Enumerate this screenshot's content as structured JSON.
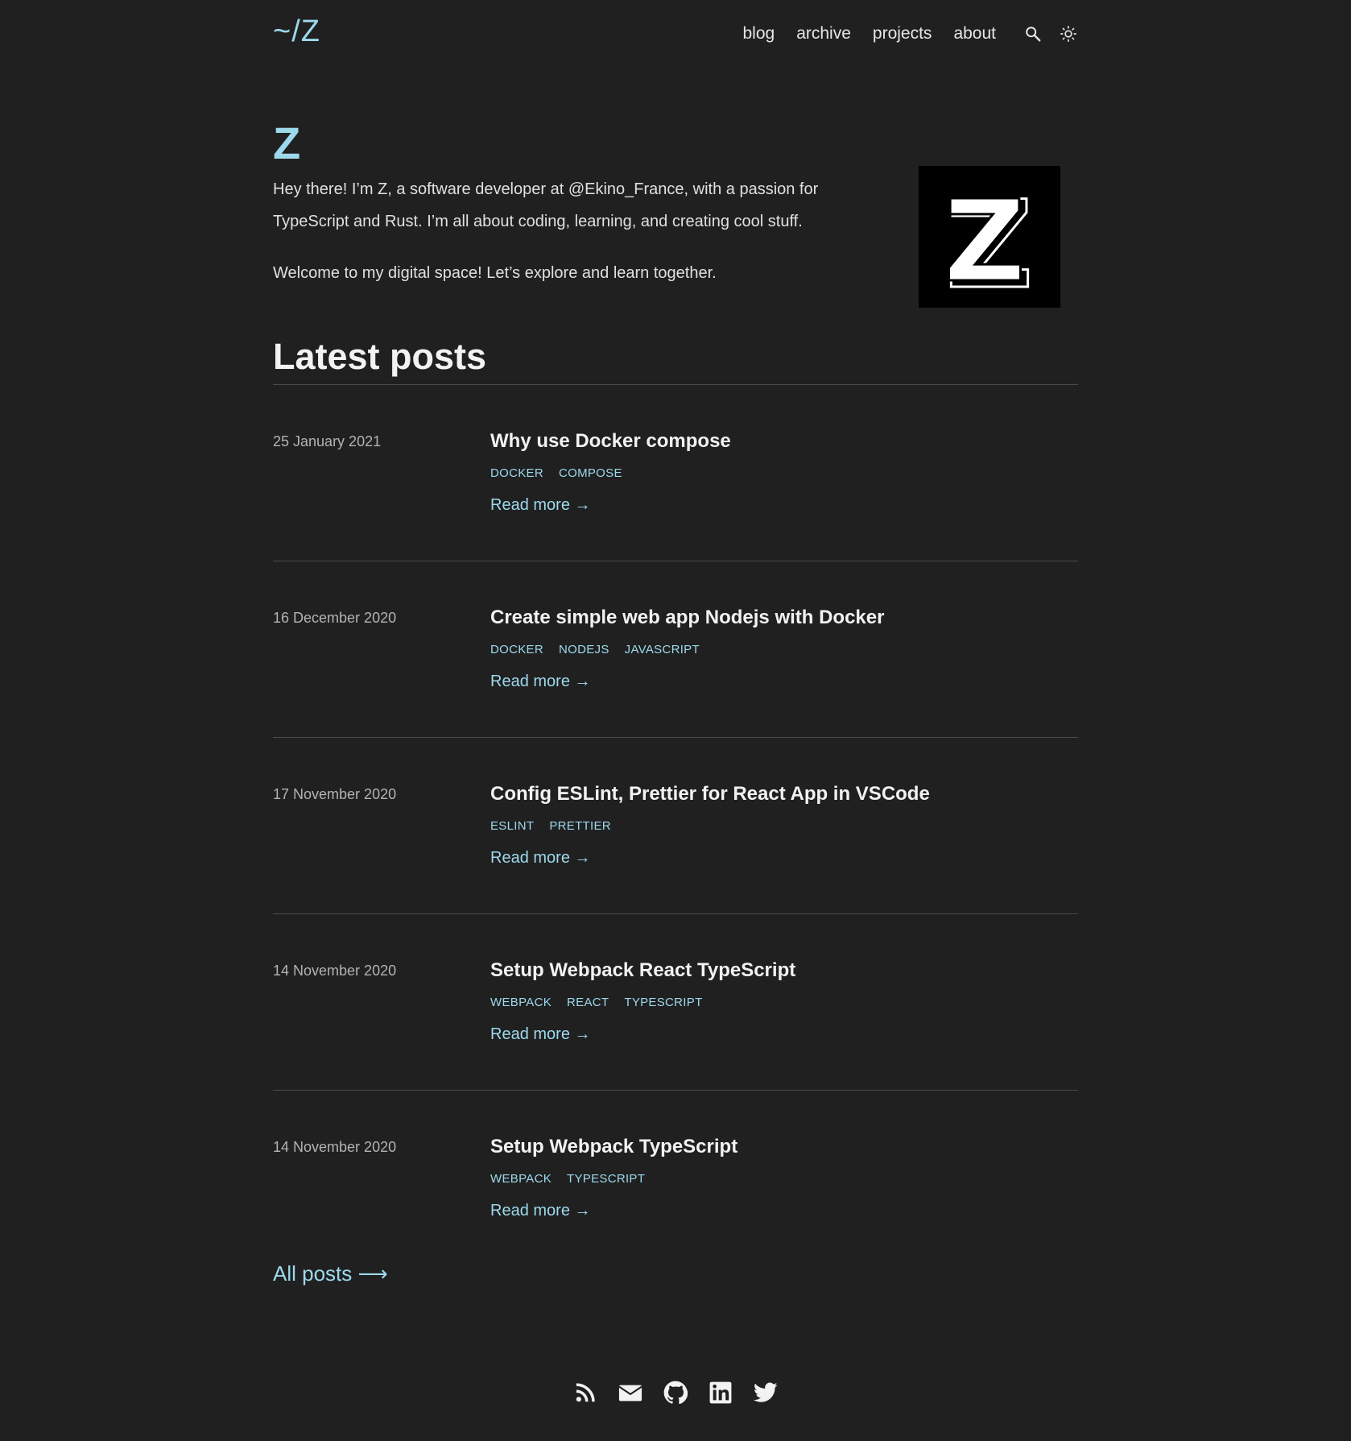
{
  "header": {
    "logo": "~/Z",
    "nav": [
      "blog",
      "archive",
      "projects",
      "about"
    ],
    "icons": [
      "search-icon",
      "sun-icon"
    ]
  },
  "intro": {
    "title": "Z",
    "paragraph1": "Hey there! I’m Z, a software developer at @Ekino_France, with a passion for TypeScript and Rust. I’m all about coding, learning, and creating cool stuff.",
    "paragraph2": "Welcome to my digital space! Let’s explore and learn together.",
    "avatar_letter": "Z"
  },
  "latest": {
    "title": "Latest posts",
    "read_more": "Read more →",
    "all_posts": "All posts ⟶",
    "posts": [
      {
        "date": "25 January 2021",
        "title": "Why use Docker compose",
        "tags": [
          "DOCKER",
          "COMPOSE"
        ]
      },
      {
        "date": "16 December 2020",
        "title": "Create simple web app Nodejs with Docker",
        "tags": [
          "DOCKER",
          "NODEJS",
          "JAVASCRIPT"
        ]
      },
      {
        "date": "17 November 2020",
        "title": "Config ESLint, Prettier for React App in VSCode",
        "tags": [
          "ESLINT",
          "PRETTIER"
        ]
      },
      {
        "date": "14 November 2020",
        "title": "Setup Webpack React TypeScript",
        "tags": [
          "WEBPACK",
          "REACT",
          "TYPESCRIPT"
        ]
      },
      {
        "date": "14 November 2020",
        "title": "Setup Webpack TypeScript",
        "tags": [
          "WEBPACK",
          "TYPESCRIPT"
        ]
      }
    ]
  },
  "footer": {
    "icons": [
      "rss-icon",
      "mail-icon",
      "github-icon",
      "linkedin-icon",
      "twitter-icon"
    ]
  },
  "colors": {
    "background": "#202020",
    "accent": "#9dd9ec",
    "text": "#e6e6e6",
    "muted": "#b3b3b3",
    "divider": "#4a4a4a"
  }
}
